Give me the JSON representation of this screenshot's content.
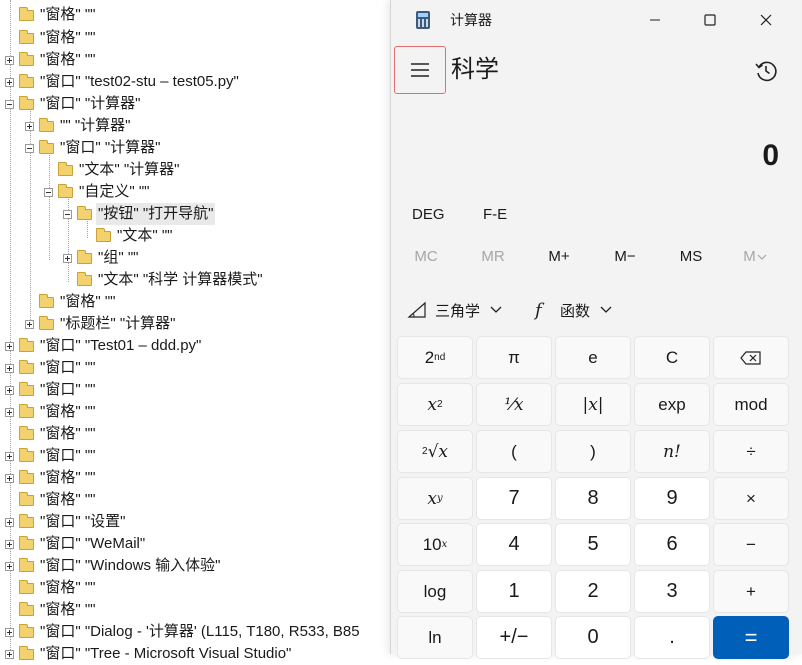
{
  "tree": {
    "rows": [
      {
        "text": "\"窗格\" \"\""
      },
      {
        "text": "\"窗格\" \"\""
      },
      {
        "text": "\"窗格\" \"\""
      },
      {
        "text": "\"窗口\" \"test02-stu – test05.py\""
      },
      {
        "text": "\"窗口\" \"计算器\""
      },
      {
        "text": "\"\" \"计算器\""
      },
      {
        "text": "\"窗口\" \"计算器\""
      },
      {
        "text": "\"文本\" \"计算器\""
      },
      {
        "text": "\"自定义\" \"\""
      },
      {
        "text": "\"按钮\" \"打开导航\""
      },
      {
        "text": "\"文本\" \"\""
      },
      {
        "text": "\"组\" \"\""
      },
      {
        "text": "\"文本\" \"科学 计算器模式\""
      },
      {
        "text": "\"窗格\" \"\""
      },
      {
        "text": "\"标题栏\" \"计算器\""
      },
      {
        "text": "\"窗口\" \"Test01 – ddd.py\""
      },
      {
        "text": "\"窗口\" \"\""
      },
      {
        "text": "\"窗口\" \"\""
      },
      {
        "text": "\"窗格\" \"\""
      },
      {
        "text": "\"窗格\" \"\""
      },
      {
        "text": "\"窗口\" \"\""
      },
      {
        "text": "\"窗格\" \"\""
      },
      {
        "text": "\"窗格\" \"\""
      },
      {
        "text": "\"窗口\" \"设置\""
      },
      {
        "text": "\"窗口\" \"WeMail\""
      },
      {
        "text": "\"窗口\" \"Windows 输入体验\""
      },
      {
        "text": "\"窗格\" \"\""
      },
      {
        "text": "\"窗格\" \"\""
      },
      {
        "text": "\"窗口\" \"Dialog - '计算器'    (L115, T180, R533, B85"
      },
      {
        "text": "\"窗口\" \"Tree - Microsoft Visual Studio\""
      }
    ]
  },
  "calculator": {
    "window_title": "计算器",
    "mode_title": "科学",
    "display": "0",
    "mode_buttons": [
      "DEG",
      "F-E"
    ],
    "memory_buttons": [
      "MC",
      "MR",
      "M+",
      "M−",
      "MS",
      "M"
    ],
    "dropdowns": {
      "trig": "三角学",
      "func": "函数"
    },
    "keys": {
      "second": "2",
      "second_sup": "nd",
      "pi": "π",
      "e": "e",
      "clear": "C",
      "x": "x",
      "sq_exp": "2",
      "recip": "⅟x",
      "abs": "|x|",
      "exp": "exp",
      "mod": "mod",
      "root_idx": "2",
      "root": "√x",
      "lparen": "(",
      "rparen": ")",
      "fact": "n!",
      "div": "÷",
      "pow_exp": "y",
      "d7": "7",
      "d8": "8",
      "d9": "9",
      "mul": "×",
      "ten": "10",
      "ten_exp": "x",
      "d4": "4",
      "d5": "5",
      "d6": "6",
      "sub": "−",
      "log": "log",
      "d1": "1",
      "d2": "2",
      "d3": "3",
      "add": "+",
      "ln": "ln",
      "neg": "+/−",
      "d0": "0",
      "dot": ".",
      "eq": "="
    }
  }
}
